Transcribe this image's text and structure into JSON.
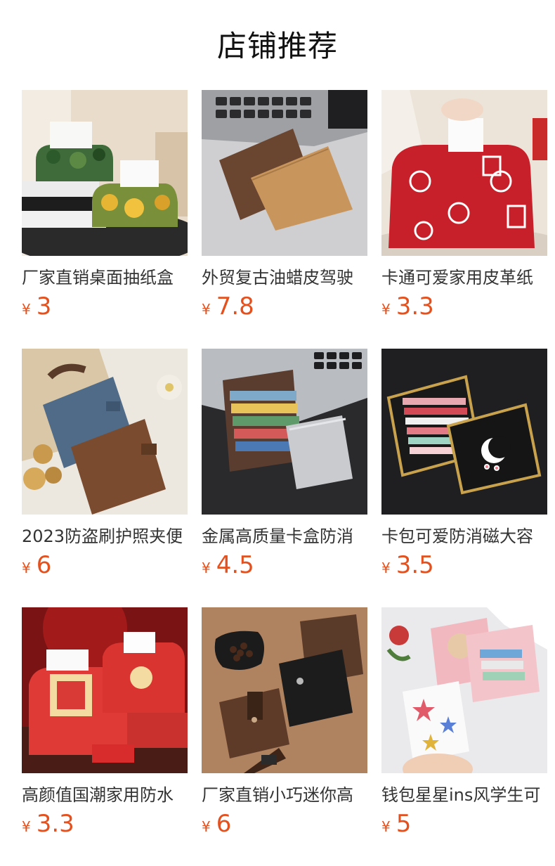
{
  "page_title": "店铺推荐",
  "currency_symbol": "¥",
  "colors": {
    "price": "#e4511f",
    "title": "#111111",
    "product_name": "#333333"
  },
  "products": [
    {
      "name": "厂家直销桌面抽纸盒",
      "price": "3",
      "icon": "tissue-box-floral-image"
    },
    {
      "name": "外贸复古油蜡皮驾驶",
      "price": "7.8",
      "icon": "brown-wallet-image"
    },
    {
      "name": "卡通可爱家用皮革纸",
      "price": "3.3",
      "icon": "red-tissue-box-image"
    },
    {
      "name": "2023防盗刷护照夹便",
      "price": "6",
      "icon": "passport-holder-image"
    },
    {
      "name": "金属高质量卡盒防消",
      "price": "4.5",
      "icon": "metal-card-case-image"
    },
    {
      "name": "卡包可爱防消磁大容",
      "price": "3.5",
      "icon": "zipper-card-wallet-image"
    },
    {
      "name": "高颜值国潮家用防水",
      "price": "3.3",
      "icon": "red-guochao-tissue-box-image"
    },
    {
      "name": "厂家直销小巧迷你高",
      "price": "6",
      "icon": "mini-leather-wallet-image"
    },
    {
      "name": "钱包星星ins风学生可",
      "price": "5",
      "icon": "pink-star-wallet-image"
    }
  ]
}
